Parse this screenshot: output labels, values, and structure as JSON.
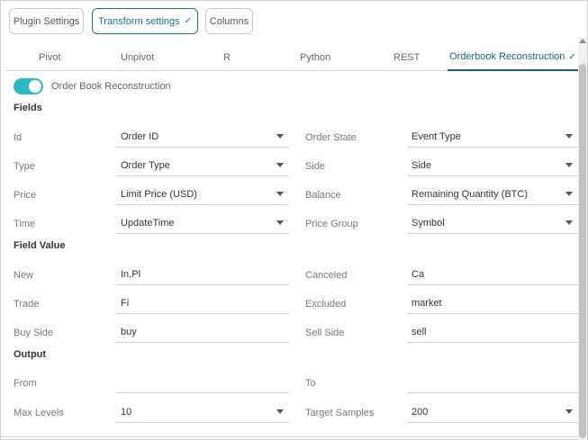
{
  "top_buttons": {
    "plugin_settings": "Plugin Settings",
    "transform_settings": "Transform settings",
    "columns": "Columns",
    "check_glyph": "✓"
  },
  "tabs": {
    "pivot": "Pivot",
    "unpivot": "Unpivot",
    "r": "R",
    "python": "Python",
    "rest": "REST",
    "orderbook": "Orderbook Reconstruction",
    "check_glyph": "✓"
  },
  "toggle": {
    "label": "Order Book Reconstruction",
    "on": true
  },
  "sections": {
    "fields": "Fields",
    "field_value": "Field Value",
    "output": "Output"
  },
  "fields": {
    "id_label": "Id",
    "id_value": "Order ID",
    "order_state_label": "Order State",
    "order_state_value": "Event Type",
    "type_label": "Type",
    "type_value": "Order Type",
    "side_label": "Side",
    "side_value": "Side",
    "price_label": "Price",
    "price_value": "Limit Price (USD)",
    "balance_label": "Balance",
    "balance_value": "Remaining Quantity (BTC)",
    "time_label": "Time",
    "time_value": "UpdateTime",
    "price_group_label": "Price Group",
    "price_group_value": "Symbol"
  },
  "field_value": {
    "new_label": "New",
    "new_value": "In,Pl",
    "canceled_label": "Canceled",
    "canceled_value": "Ca",
    "trade_label": "Trade",
    "trade_value": "Fi",
    "excluded_label": "Excluded",
    "excluded_value": "market",
    "buy_side_label": "Buy Side",
    "buy_side_value": "buy",
    "sell_side_label": "Sell Side",
    "sell_side_value": "sell"
  },
  "output": {
    "from_label": "From",
    "from_value": "",
    "to_label": "To",
    "to_value": "",
    "max_levels_label": "Max Levels",
    "max_levels_value": "10",
    "target_samples_label": "Target Samples",
    "target_samples_value": "200"
  },
  "colors": {
    "accent": "#1f6f86",
    "toggle_on": "#2eb7c2"
  }
}
